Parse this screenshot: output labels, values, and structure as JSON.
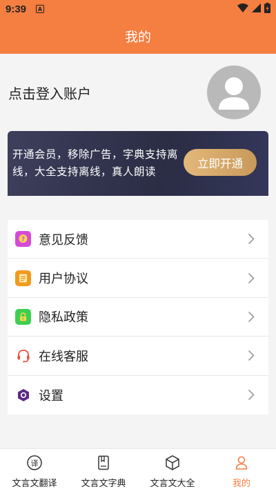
{
  "status_bar": {
    "time": "9:39",
    "a_badge": "A"
  },
  "header": {
    "title": "我的"
  },
  "profile": {
    "login_text": "点击登入账户"
  },
  "vip": {
    "description": "开通会员，移除广告，字典支持离线，大全支持离线，真人朗读",
    "button_label": "立即开通"
  },
  "menu": {
    "items": [
      {
        "label": "意见反馈",
        "icon": "feedback-icon",
        "color": "#d64ad8"
      },
      {
        "label": "用户协议",
        "icon": "agreement-icon",
        "color": "#f29a1e"
      },
      {
        "label": "隐私政策",
        "icon": "privacy-lock-icon",
        "color": "#3ecf52"
      },
      {
        "label": "在线客服",
        "icon": "headset-icon",
        "color": "#e8503a"
      },
      {
        "label": "设置",
        "icon": "settings-icon",
        "color": "#5b2a86"
      }
    ]
  },
  "tabs": [
    {
      "label": "文言文翻译",
      "icon": "translate-icon",
      "active": false
    },
    {
      "label": "文言文字典",
      "icon": "dictionary-icon",
      "active": false
    },
    {
      "label": "文言文大全",
      "icon": "cube-icon",
      "active": false
    },
    {
      "label": "我的",
      "icon": "person-icon",
      "active": true
    }
  ],
  "colors": {
    "accent": "#f57e41",
    "vip_gold": "#d6aa6c",
    "vip_dark": "#2e3049"
  }
}
